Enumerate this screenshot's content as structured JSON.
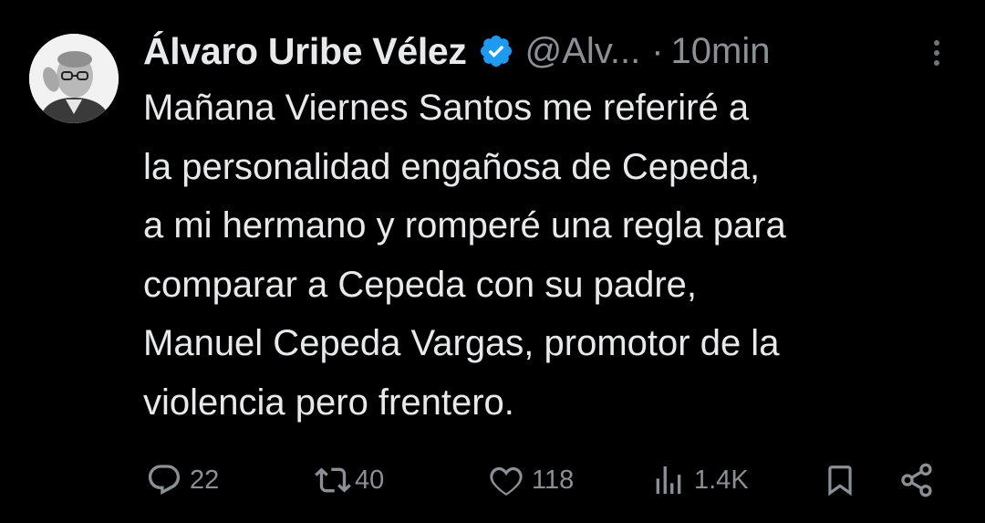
{
  "tweet": {
    "author": {
      "display_name": "Álvaro Uribe Vélez",
      "handle": "@Alv...",
      "verified": true,
      "verified_color": "#1d9bf0"
    },
    "separator": "·",
    "time": "10min",
    "more_icon": "more-vertical-icon",
    "text": "Mañana Viernes Santos me referiré a\nla personalidad engañosa de Cepeda,\na mi hermano y romperé una regla para\ncomparar a Cepeda con su padre,\nManuel Cepeda Vargas, promotor de la\nviolencia pero frentero.",
    "actions": {
      "replies": "22",
      "retweets": "40",
      "likes": "118",
      "views": "1.4K"
    }
  },
  "colors": {
    "background": "#000000",
    "text": "#e7e9ea",
    "muted": "#8b9096",
    "accent": "#1d9bf0"
  }
}
